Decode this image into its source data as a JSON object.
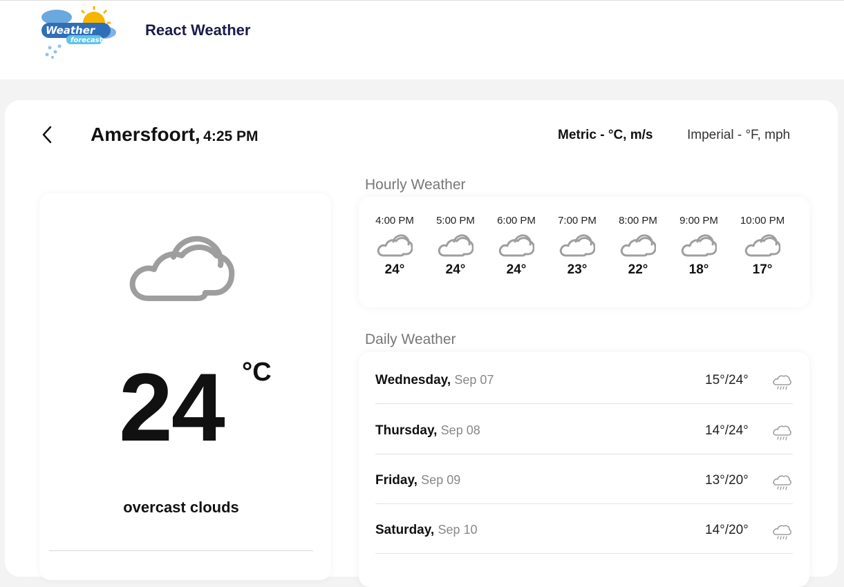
{
  "header": {
    "logo_text_main": "Weather",
    "logo_text_sub": "forecast",
    "app_title": "React Weather"
  },
  "location": {
    "city": "Amersfoort,",
    "time": "4:25 PM"
  },
  "units": {
    "metric_label": "Metric - °C, m/s",
    "imperial_label": "Imperial - °F, mph",
    "selected": "metric"
  },
  "current": {
    "temperature": "24",
    "unit": "°C",
    "condition": "overcast clouds",
    "icon": "cloud-icon"
  },
  "hourly": {
    "title": "Hourly Weather",
    "items": [
      {
        "time": "4:00 PM",
        "temp": "24°",
        "icon": "cloud-icon"
      },
      {
        "time": "5:00 PM",
        "temp": "24°",
        "icon": "cloud-icon"
      },
      {
        "time": "6:00 PM",
        "temp": "24°",
        "icon": "cloud-icon"
      },
      {
        "time": "7:00 PM",
        "temp": "23°",
        "icon": "cloud-icon"
      },
      {
        "time": "8:00 PM",
        "temp": "22°",
        "icon": "cloud-icon"
      },
      {
        "time": "9:00 PM",
        "temp": "18°",
        "icon": "cloud-icon"
      },
      {
        "time": "10:00 PM",
        "temp": "17°",
        "icon": "cloud-icon"
      }
    ]
  },
  "daily": {
    "title": "Daily Weather",
    "items": [
      {
        "day": "Wednesday,",
        "date": "Sep 07",
        "range": "15°/24°",
        "icon": "rain-cloud-icon"
      },
      {
        "day": "Thursday,",
        "date": "Sep 08",
        "range": "14°/24°",
        "icon": "rain-cloud-icon"
      },
      {
        "day": "Friday,",
        "date": "Sep 09",
        "range": "13°/20°",
        "icon": "rain-cloud-icon"
      },
      {
        "day": "Saturday,",
        "date": "Sep 10",
        "range": "14°/20°",
        "icon": "rain-cloud-icon"
      }
    ]
  },
  "colors": {
    "background": "#f3f3f3",
    "card": "#ffffff",
    "title_navy": "#1c1c4a",
    "icon_gray": "#9e9e9e",
    "muted_text": "#888888"
  }
}
